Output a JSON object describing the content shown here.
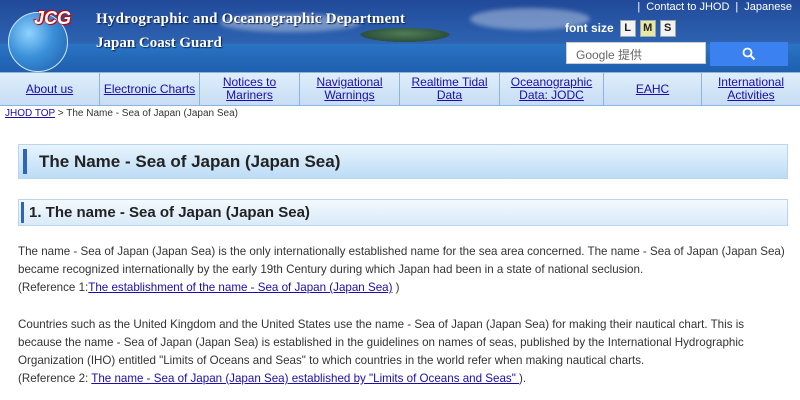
{
  "header": {
    "logo_text": "JCG",
    "department": "Hydrographic and Oceanographic Department",
    "organization": "Japan Coast Guard",
    "top_links": [
      "Contact to JHOD",
      "Japanese"
    ],
    "font_size_label": "font size",
    "font_sizes": [
      "L",
      "M",
      "S"
    ],
    "selected_font_size": "M",
    "search_placeholder": "Google 提供"
  },
  "nav": {
    "items": [
      "About us",
      "Electronic Charts",
      "Notices to Mariners",
      "Navigational Warnings",
      "Realtime Tidal Data",
      "Oceanographic Data: JODC",
      "EAHC",
      "International Activities"
    ]
  },
  "breadcrumb": {
    "home": "JHOD TOP",
    "separator": " > ",
    "current": "The Name - Sea of Japan (Japan Sea)"
  },
  "page_title": "The Name - Sea of Japan (Japan Sea)",
  "section_title": "1. The name - Sea of Japan (Japan Sea)",
  "paragraph1": {
    "text": "The name - Sea of Japan (Japan Sea) is the only internationally established name for the sea area concerned. The name - Sea of Japan (Japan Sea) became recognized internationally by the early 19th Century during which Japan had been in a state of national seclusion.",
    "ref_prefix": "(Reference 1:",
    "ref_link": "The establishment of the name - Sea of Japan (Japan Sea)",
    "ref_suffix": " )"
  },
  "paragraph2": {
    "text": "Countries such as the United Kingdom and the United States use the name - Sea of Japan (Japan Sea) for making their nautical chart. This is because the name - Sea of Japan (Japan Sea) is established in the guidelines on names of seas, published by the International Hydrographic Organization (IHO) entitled \"Limits of Oceans and Seas\" to which countries in the world refer when making nautical charts.",
    "ref_prefix": "(Reference 2: ",
    "ref_link": "The name - Sea of Japan (Japan Sea) established by \"Limits of Oceans and Seas\" ",
    "ref_suffix": ")."
  }
}
